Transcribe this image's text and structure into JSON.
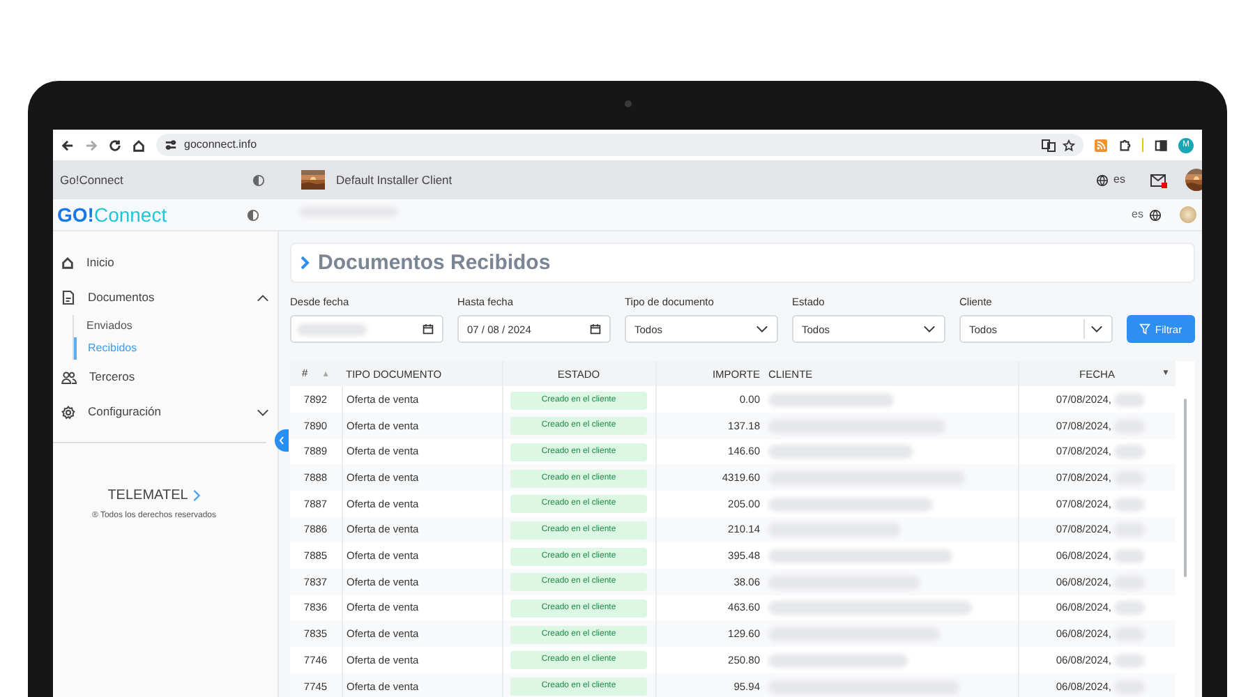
{
  "browser": {
    "url": "goconnect.info",
    "profile_initial": "M"
  },
  "topbar": {
    "app_name": "Go!Connect",
    "client": "Default Installer Client",
    "language": "es",
    "mail_unread": true
  },
  "header": {
    "logo": {
      "mark": "GO!",
      "word": "Connect"
    },
    "user_redacted": true,
    "language": "es"
  },
  "sidebar": {
    "items": [
      {
        "label": "Inicio",
        "kind": "home",
        "selected": false
      },
      {
        "label": "Documentos",
        "kind": "document",
        "expanded": true,
        "selected": false,
        "children": [
          {
            "label": "Enviados",
            "selected": false
          },
          {
            "label": "Recibidos",
            "selected": true
          }
        ]
      },
      {
        "label": "Terceros",
        "kind": "people",
        "selected": false
      },
      {
        "label": "Configuración",
        "kind": "gear",
        "expanded": false,
        "selected": false
      }
    ],
    "footer": {
      "brand": "TELEMATEL",
      "rights": "® Todos los derechos reservados"
    }
  },
  "page_title": "Documentos Recibidos",
  "filters": [
    {
      "label": "Desde fecha",
      "kind": "date",
      "redacted": true
    },
    {
      "label": "Hasta fecha",
      "kind": "date",
      "value": "07 / 08 / 2024"
    },
    {
      "label": "Tipo de documento",
      "kind": "select",
      "value": "Todos"
    },
    {
      "label": "Estado",
      "kind": "select",
      "value": "Todos"
    },
    {
      "label": "Cliente",
      "kind": "select",
      "value": "Todos",
      "divider": true
    }
  ],
  "filter_button": "Filtrar",
  "table": {
    "columns": [
      {
        "label": "#",
        "sort_icon": "▲"
      },
      {
        "label": "TIPO DOCUMENTO"
      },
      {
        "label": "ESTADO"
      },
      {
        "label": "IMPORTE"
      },
      {
        "label": "CLIENTE"
      },
      {
        "label": "FECHA",
        "sort_icon": "▼"
      }
    ],
    "rows": [
      {
        "id": "7892",
        "type": "Oferta de venta",
        "status": "Creado en el cliente",
        "amount": "0.00",
        "date": "07/08/2024,"
      },
      {
        "id": "7890",
        "type": "Oferta de venta",
        "status": "Creado en el cliente",
        "amount": "137.18",
        "date": "07/08/2024,"
      },
      {
        "id": "7889",
        "type": "Oferta de venta",
        "status": "Creado en el cliente",
        "amount": "146.60",
        "date": "07/08/2024,"
      },
      {
        "id": "7888",
        "type": "Oferta de venta",
        "status": "Creado en el cliente",
        "amount": "4319.60",
        "date": "07/08/2024,"
      },
      {
        "id": "7887",
        "type": "Oferta de venta",
        "status": "Creado en el cliente",
        "amount": "205.00",
        "date": "07/08/2024,"
      },
      {
        "id": "7886",
        "type": "Oferta de venta",
        "status": "Creado en el cliente",
        "amount": "210.14",
        "date": "07/08/2024,"
      },
      {
        "id": "7885",
        "type": "Oferta de venta",
        "status": "Creado en el cliente",
        "amount": "395.48",
        "date": "06/08/2024,"
      },
      {
        "id": "7837",
        "type": "Oferta de venta",
        "status": "Creado en el cliente",
        "amount": "38.06",
        "date": "06/08/2024,"
      },
      {
        "id": "7836",
        "type": "Oferta de venta",
        "status": "Creado en el cliente",
        "amount": "463.60",
        "date": "06/08/2024,"
      },
      {
        "id": "7835",
        "type": "Oferta de venta",
        "status": "Creado en el cliente",
        "amount": "129.60",
        "date": "06/08/2024,"
      },
      {
        "id": "7746",
        "type": "Oferta de venta",
        "status": "Creado en el cliente",
        "amount": "250.80",
        "date": "06/08/2024,"
      },
      {
        "id": "7745",
        "type": "Oferta de venta",
        "status": "Creado en el cliente",
        "amount": "95.94",
        "date": "06/08/2024,"
      }
    ]
  }
}
